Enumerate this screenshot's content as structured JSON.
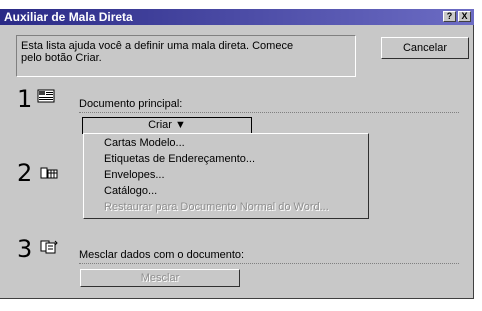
{
  "window": {
    "title": "Auxiliar de Mala Direta",
    "help_glyph": "?",
    "close_glyph": "X"
  },
  "info": {
    "text_line1": "Esta lista ajuda você a definir uma mala direta. Comece",
    "text_line2": "pelo botão Criar."
  },
  "buttons": {
    "cancel": "Cancelar",
    "create": "Criar",
    "merge": "Mesclar"
  },
  "steps": [
    {
      "number": "1",
      "label": "Documento principal:",
      "icon": "main-document-icon"
    },
    {
      "number": "2",
      "label": "",
      "icon": "data-source-icon"
    },
    {
      "number": "3",
      "label": "Mesclar dados com o documento:",
      "icon": "merge-icon"
    }
  ],
  "menu": {
    "items": [
      {
        "label": "Cartas Modelo...",
        "enabled": true
      },
      {
        "label": "Etiquetas de Endereçamento...",
        "enabled": true
      },
      {
        "label": "Envelopes...",
        "enabled": true
      },
      {
        "label": "Catálogo...",
        "enabled": true
      },
      {
        "label": "Restaurar para Documento Normal do Word...",
        "enabled": false
      }
    ]
  },
  "colors": {
    "titlebar_start": "#2a2a86",
    "titlebar_end": "#6c6cc4",
    "face": "#c8c8c8"
  }
}
